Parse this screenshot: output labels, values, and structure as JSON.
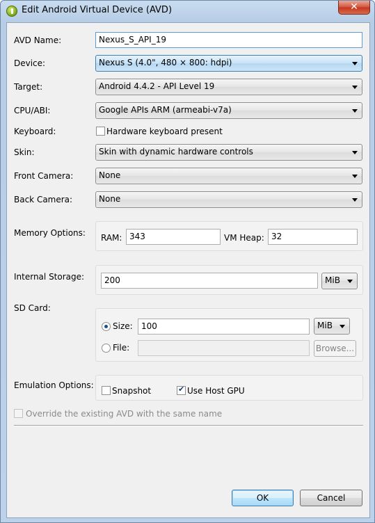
{
  "window": {
    "title": "Edit Android Virtual Device (AVD)",
    "close_glyph": "✕"
  },
  "form": {
    "avd_name": {
      "label": "AVD Name:",
      "value": "Nexus_S_API_19"
    },
    "device": {
      "label": "Device:",
      "value": "Nexus S (4.0\", 480 × 800: hdpi)"
    },
    "target": {
      "label": "Target:",
      "value": "Android 4.4.2 - API Level 19"
    },
    "cpu_abi": {
      "label": "CPU/ABI:",
      "value": "Google APIs ARM (armeabi-v7a)"
    },
    "keyboard": {
      "label": "Keyboard:",
      "checkbox_label": "Hardware keyboard present",
      "checked": false
    },
    "skin": {
      "label": "Skin:",
      "value": "Skin with dynamic hardware controls"
    },
    "front_camera": {
      "label": "Front Camera:",
      "value": "None"
    },
    "back_camera": {
      "label": "Back Camera:",
      "value": "None"
    },
    "memory": {
      "label": "Memory Options:",
      "ram_label": "RAM:",
      "ram_value": "343",
      "vm_heap_label": "VM Heap:",
      "vm_heap_value": "32"
    },
    "internal_storage": {
      "label": "Internal Storage:",
      "value": "200",
      "unit": "MiB"
    },
    "sd_card": {
      "label": "SD Card:",
      "size_label": "Size:",
      "size_value": "100",
      "size_unit": "MiB",
      "file_label": "File:",
      "file_value": "",
      "browse_label": "Browse...",
      "selected": "size"
    },
    "emulation": {
      "label": "Emulation Options:",
      "snapshot_label": "Snapshot",
      "snapshot_checked": false,
      "host_gpu_label": "Use Host GPU",
      "host_gpu_checked": true
    },
    "override": {
      "label": "Override the existing AVD with the same name",
      "checked": false,
      "enabled": false
    }
  },
  "buttons": {
    "ok": "OK",
    "cancel": "Cancel"
  }
}
